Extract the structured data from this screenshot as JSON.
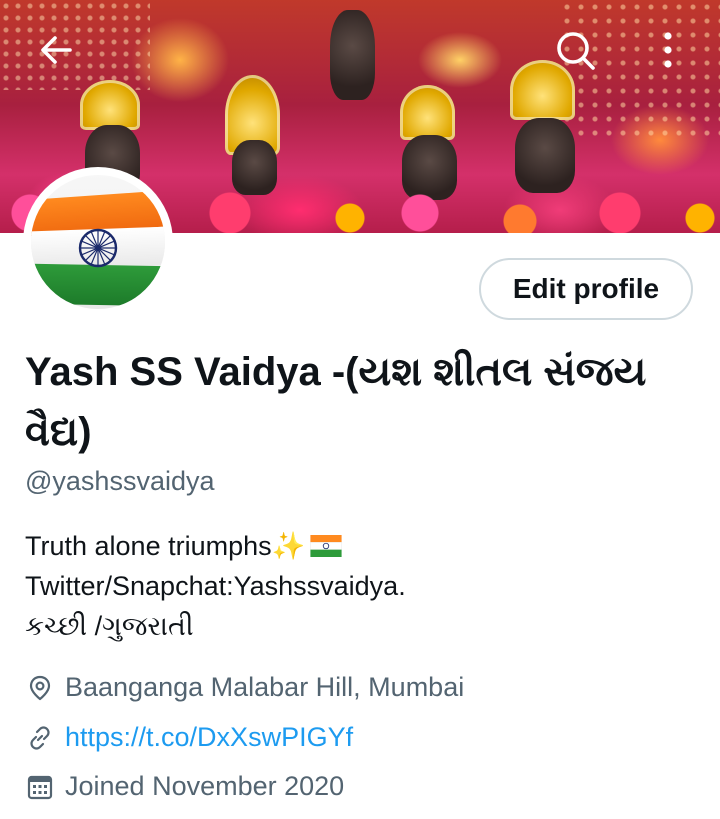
{
  "header": {
    "back_icon": "arrow-left-icon",
    "search_icon": "search-icon",
    "more_icon": "more-vertical-icon"
  },
  "profile": {
    "edit_button_label": "Edit profile",
    "display_name": "Yash SS Vaidya -(યશ શીતલ સંજય વૈદ્ય)",
    "handle": "@yashssvaidya",
    "bio": {
      "line1": "Truth alone triumphs✨",
      "line2": "Twitter/Snapchat:Yashssvaidya.",
      "line3": "કચ્છી /ગુજરાતી"
    },
    "location": "Baanganga Malabar Hill, Mumbai",
    "website": "https://t.co/DxXswPIGYf",
    "joined": "Joined November 2020"
  },
  "colors": {
    "accent": "#1d9bf0",
    "secondary_text": "#536471",
    "primary_text": "#0f1419",
    "border": "#cfd9de"
  }
}
